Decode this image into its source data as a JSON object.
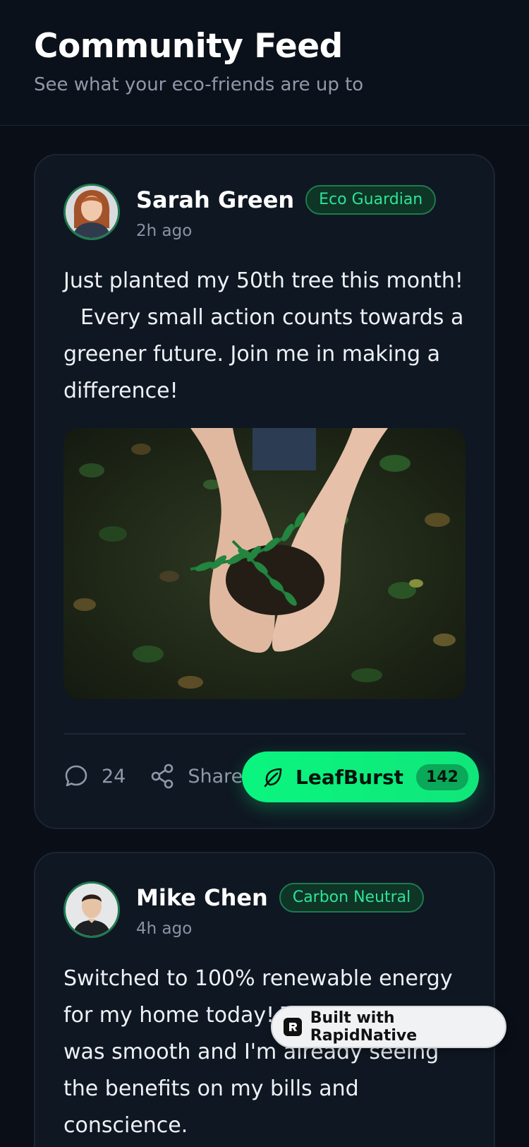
{
  "header": {
    "title": "Community Feed",
    "subtitle": "See what your eco-friends are up to"
  },
  "posts": [
    {
      "author": "Sarah Green",
      "badge": "Eco Guardian",
      "time": "2h ago",
      "text_lines": [
        "Just planted my 50th tree this month!",
        "Every small action counts towards a",
        "greener future. Join me in making a",
        "difference!"
      ],
      "comments": "24",
      "share_label": "Share",
      "leafburst_label": "LeafBurst",
      "leafburst_count": "142"
    },
    {
      "author": "Mike Chen",
      "badge": "Carbon Neutral",
      "time": "4h ago",
      "text_lines": [
        "Switched to 100% renewable energy",
        "for my home today! The installation",
        "was smooth and I'm already seeing",
        "the benefits on my bills and",
        "conscience."
      ]
    }
  ],
  "overlay": {
    "built_with": "Built with RapidNative"
  },
  "icons": {
    "comment": "comment-bubble-icon",
    "share": "share-icon",
    "leaf": "leaf-icon",
    "brand": "rapidnative-logo-icon"
  },
  "colors": {
    "accent": "#10e67a",
    "badge_text": "#2ee39a",
    "background": "#0a0e17",
    "card": "#0f1722"
  }
}
